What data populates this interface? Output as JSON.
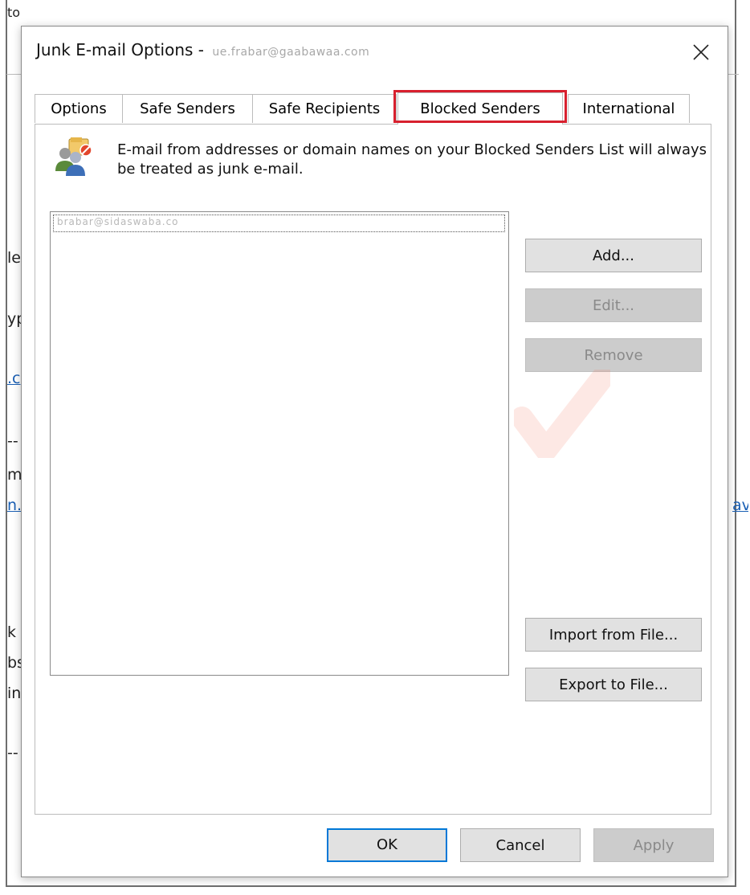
{
  "background": {
    "left_fragments": [
      {
        "text": "to",
        "link": false
      },
      {
        "text": "le",
        "link": false
      },
      {
        "text": "yp",
        "link": false
      },
      {
        "text": ".c",
        "link": true
      },
      {
        "text": "--",
        "link": false
      },
      {
        "text": "m",
        "link": false
      },
      {
        "text": "n.",
        "link": true
      },
      {
        "text": "k",
        "link": false
      },
      {
        "text": "bs",
        "link": false
      },
      {
        "text": "in",
        "link": false
      },
      {
        "text": "--",
        "link": false
      }
    ],
    "right_fragment": "av"
  },
  "dialog": {
    "title": "Junk E-mail Options -",
    "title_account": "ue.frabar@gaabawaa.com",
    "tabs": [
      {
        "label": "Options",
        "active": false
      },
      {
        "label": "Safe Senders",
        "active": false
      },
      {
        "label": "Safe Recipients",
        "active": false
      },
      {
        "label": "Blocked Senders",
        "active": true
      },
      {
        "label": "International",
        "active": false
      }
    ],
    "description": "E-mail from addresses or domain names on your Blocked Senders List will always be treated as junk e-mail.",
    "list_items": [
      "brabar@sidaswaba.co"
    ],
    "buttons": {
      "add": "Add...",
      "edit": "Edit...",
      "remove": "Remove",
      "import": "Import from File...",
      "export": "Export to File..."
    },
    "footer": {
      "ok": "OK",
      "cancel": "Cancel",
      "apply": "Apply"
    }
  },
  "watermark": "vinahost",
  "colors": {
    "highlight": "#d8202e",
    "default_button_border": "#0078d7",
    "button_bg": "#e1e1e1",
    "disabled_button_bg": "#cccccc"
  }
}
